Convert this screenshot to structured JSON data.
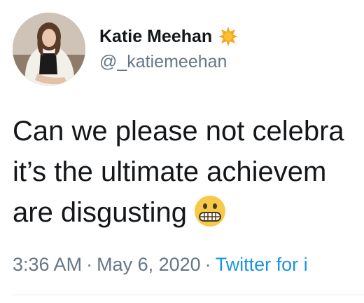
{
  "author": {
    "display_name": "Katie Meehan",
    "handle": "@_katiemeehan",
    "badge_icon": "verified-sun-badge-icon",
    "badge_color": "#f5a623"
  },
  "tweet": {
    "lines": [
      "Can we please not celebra",
      "it’s the ultimate achievem",
      "are disgusting"
    ],
    "emoji": "grimacing-face-icon"
  },
  "meta": {
    "time": "3:36 AM",
    "separator": "·",
    "date": "May 6, 2020",
    "source": "Twitter for i",
    "link_color": "#1b95e0"
  }
}
